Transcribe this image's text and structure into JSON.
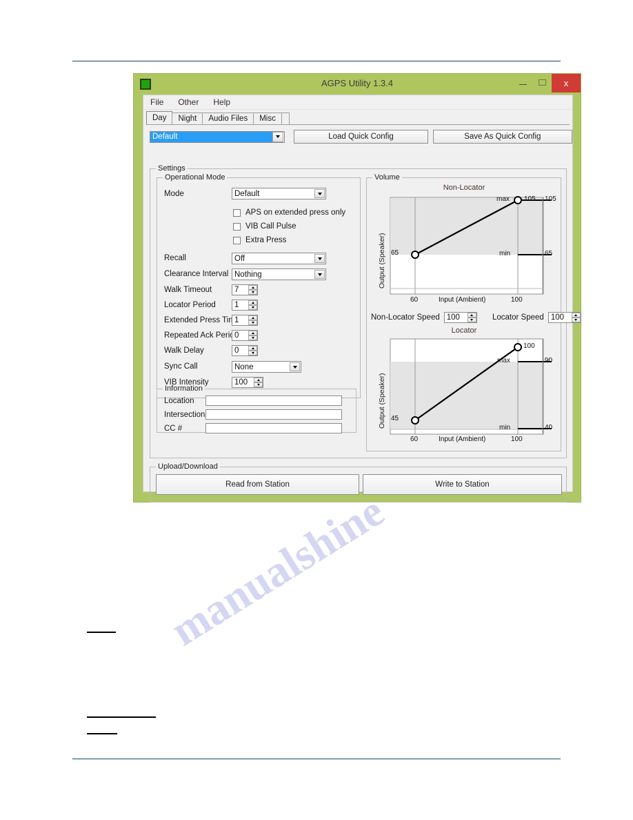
{
  "window": {
    "title": "AGPS Utility 1.3.4",
    "app_icon": "green-square-icon",
    "minimize_label": "–",
    "maximize_label": "□",
    "close_label": "x"
  },
  "menubar": {
    "items": [
      "File",
      "Other",
      "Help"
    ]
  },
  "tabs": [
    {
      "label": "Day",
      "selected": true
    },
    {
      "label": "Night",
      "selected": false
    },
    {
      "label": "Audio Files",
      "selected": false
    },
    {
      "label": "Misc",
      "selected": false
    }
  ],
  "quick_config": {
    "profile_value": "Default",
    "load_label": "Load Quick Config",
    "save_label": "Save As Quick Config"
  },
  "settings": {
    "title": "Settings",
    "operational_mode": {
      "title": "Operational Mode",
      "mode_label": "Mode",
      "mode_value": "Default",
      "checkboxes": [
        {
          "label": "APS on extended press only",
          "checked": false
        },
        {
          "label": "VIB Call Pulse",
          "checked": false
        },
        {
          "label": "Extra Press",
          "checked": false
        }
      ],
      "fields": [
        {
          "label": "Recall",
          "value": "Off",
          "type": "dropdown"
        },
        {
          "label": "Clearance Interval",
          "value": "Nothing",
          "type": "dropdown"
        },
        {
          "label": "Walk Timeout",
          "value": "7",
          "type": "spinner"
        },
        {
          "label": "Locator Period",
          "value": "1",
          "type": "spinner"
        },
        {
          "label": "Extended Press Time",
          "value": "1",
          "type": "spinner"
        },
        {
          "label": "Repeated Ack Period",
          "value": "0",
          "type": "spinner"
        },
        {
          "label": "Walk Delay",
          "value": "0",
          "type": "spinner"
        },
        {
          "label": "Sync Call",
          "value": "None",
          "type": "dropdown"
        },
        {
          "label": "VIB Intensity",
          "value": "100",
          "type": "spinner"
        }
      ]
    },
    "information": {
      "title": "Information",
      "fields": [
        {
          "label": "Location",
          "value": ""
        },
        {
          "label": "Intersection",
          "value": ""
        },
        {
          "label": "CC #",
          "value": ""
        }
      ]
    },
    "volume": {
      "title": "Volume",
      "non_locator_speed_label": "Non-Locator Speed",
      "non_locator_speed_value": "100",
      "locator_speed_label": "Locator Speed",
      "locator_speed_value": "100"
    }
  },
  "upload_download": {
    "title": "Upload/Download",
    "read_label": "Read from Station",
    "write_label": "Write to Station"
  },
  "chart_data": [
    {
      "type": "line",
      "title": "Non-Locator",
      "xlabel": "Input (Ambient)",
      "ylabel": "Output (Speaker)",
      "x": [
        60,
        100
      ],
      "values": [
        65,
        105
      ],
      "xticks": [
        "60",
        "100"
      ],
      "xlim": [
        45,
        115
      ],
      "ylim": [
        30,
        115
      ],
      "point_labels": {
        "left": "65",
        "right": "105"
      },
      "band_min_label": "min",
      "band_max_label": "max",
      "band_min_value": "65",
      "band_max_value": "105",
      "grid": false,
      "legend": "none",
      "accent": "#000000",
      "band_color": "#e4e4e4"
    },
    {
      "type": "line",
      "title": "Locator",
      "xlabel": "Input (Ambient)",
      "ylabel": "Output (Speaker)",
      "x": [
        60,
        100
      ],
      "values": [
        45,
        100
      ],
      "xticks": [
        "60",
        "100"
      ],
      "xlim": [
        45,
        115
      ],
      "ylim": [
        30,
        110
      ],
      "point_labels": {
        "left": "45",
        "right": "100"
      },
      "band_min_label": "min",
      "band_max_label": "max",
      "band_min_value": "40",
      "band_max_value": "90",
      "grid": false,
      "legend": "none",
      "accent": "#000000",
      "band_color": "#e4e4e4"
    }
  ],
  "colors": {
    "window_frame": "#aec764",
    "titlebar": "#afc65f",
    "close_button": "#cf3b35",
    "selection": "#2a9df4",
    "page_rule": "#0b4a6b"
  }
}
